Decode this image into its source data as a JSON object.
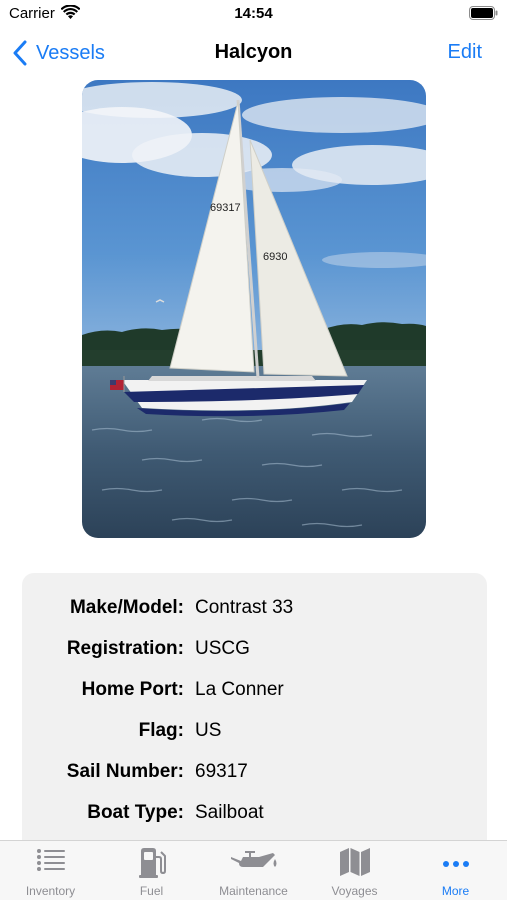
{
  "status_bar": {
    "carrier": "Carrier",
    "time": "14:54"
  },
  "nav": {
    "back_label": "Vessels",
    "title": "Halcyon",
    "edit_label": "Edit"
  },
  "photo": {
    "sail_number_text": "69317",
    "sail_number_text_2": "6930"
  },
  "details": [
    {
      "label": "Make/Model:",
      "value": "Contrast 33"
    },
    {
      "label": "Registration:",
      "value": "USCG"
    },
    {
      "label": "Home Port:",
      "value": "La Conner"
    },
    {
      "label": "Flag:",
      "value": "US"
    },
    {
      "label": "Sail Number:",
      "value": "69317"
    },
    {
      "label": "Boat Type:",
      "value": "Sailboat"
    }
  ],
  "tabs": [
    {
      "label": "Inventory",
      "icon": "list-icon",
      "active": false
    },
    {
      "label": "Fuel",
      "icon": "fuel-pump-icon",
      "active": false
    },
    {
      "label": "Maintenance",
      "icon": "oil-can-icon",
      "active": false
    },
    {
      "label": "Voyages",
      "icon": "map-icon",
      "active": false
    },
    {
      "label": "More",
      "icon": "more-dots-icon",
      "active": true
    }
  ],
  "colors": {
    "accent": "#1a7cf5",
    "inactive_tab": "#8e8e93",
    "card_bg": "#f1f1f1"
  }
}
